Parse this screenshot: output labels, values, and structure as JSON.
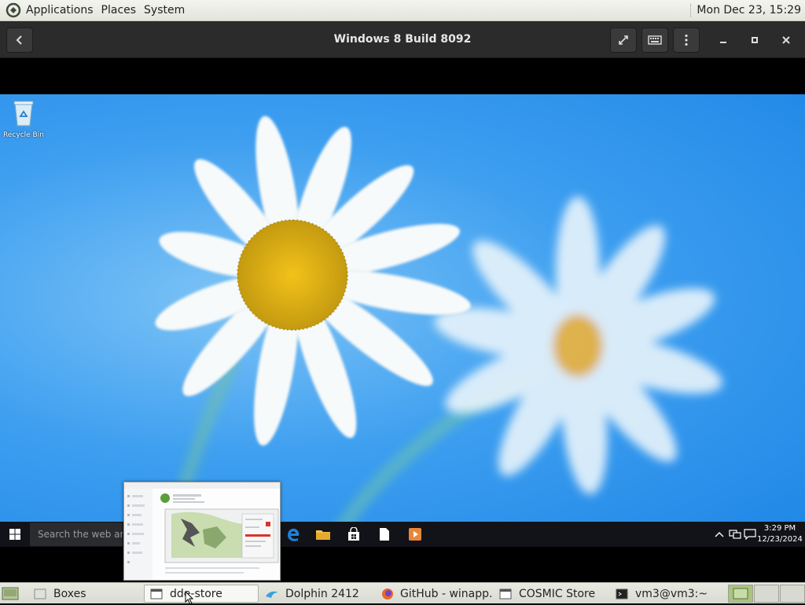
{
  "top_panel": {
    "menus": [
      "Applications",
      "Places",
      "System"
    ],
    "clock": "Mon Dec 23, 15:29"
  },
  "headerbar": {
    "title": "Windows 8 Build 8092",
    "icons": [
      "back-icon",
      "fullscreen-icon",
      "keyboard-icon",
      "menu-dots-icon",
      "minimize-icon",
      "maximize-icon",
      "close-icon"
    ]
  },
  "guest": {
    "desktop_icon_label": "Recycle Bin",
    "search_placeholder": "Search the web and Windows",
    "clock_time": "3:29 PM",
    "clock_date": "12/23/2024"
  },
  "taskbar": {
    "tasks": [
      "Boxes",
      "dde-store",
      "Dolphin 2412",
      "GitHub - winapp...",
      "COSMIC Store",
      "vm3@vm3:~"
    ]
  },
  "colors": {
    "desktop_blue": "#2a8ef0",
    "header_bg": "#2b2b2b",
    "panel_bg": "#e3e5dc"
  }
}
